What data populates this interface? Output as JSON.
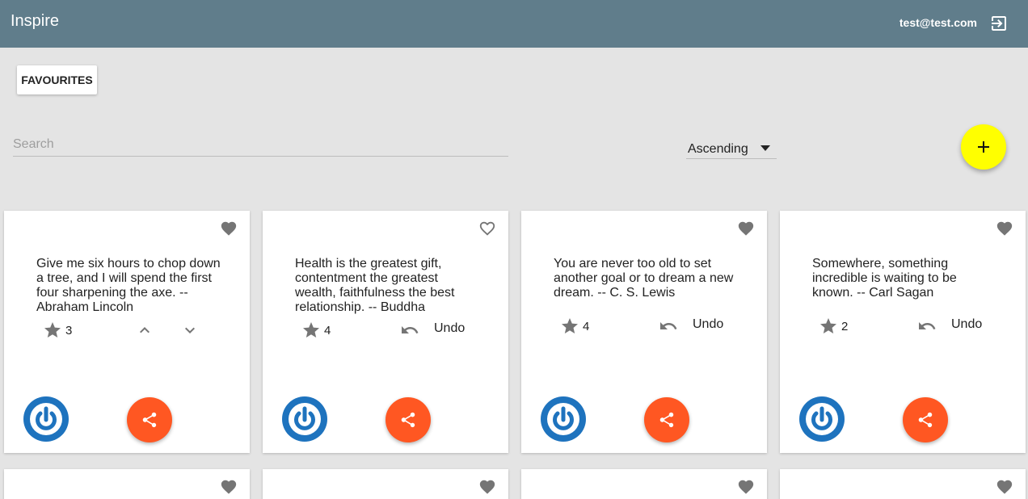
{
  "appbar": {
    "title": "Inspire",
    "user_email": "test@test.com",
    "color": "#607d8b"
  },
  "toolbar": {
    "favourites_label": "FAVOURITES",
    "search_placeholder": "Search",
    "sort_value": "Ascending"
  },
  "colors": {
    "fab": "#ffff00",
    "share": "#ff5722",
    "avatar": "#1e73be",
    "icon": "#757575"
  },
  "cards": [
    {
      "quote": "Give me six hours to chop down a tree, and I will spend the first four sharpening the axe. -- Abraham Lincoln",
      "count": "3",
      "favourited": true,
      "mode": "vote"
    },
    {
      "quote": "Health is the greatest gift, contentment the greatest wealth, faithfulness the best relationship. -- Buddha",
      "count": "4",
      "favourited": false,
      "mode": "undo",
      "undo_label": "Undo"
    },
    {
      "quote": "You are never too old to set another goal or to dream a new dream. -- C. S. Lewis",
      "count": "4",
      "favourited": true,
      "mode": "undo",
      "undo_label": "Undo"
    },
    {
      "quote": "Somewhere, something incredible is waiting to be known. -- Carl Sagan",
      "count": "2",
      "favourited": true,
      "mode": "undo",
      "undo_label": "Undo"
    }
  ],
  "cards_row2": [
    {
      "favourited": true
    },
    {
      "favourited": true
    },
    {
      "favourited": true
    },
    {
      "favourited": true
    }
  ]
}
